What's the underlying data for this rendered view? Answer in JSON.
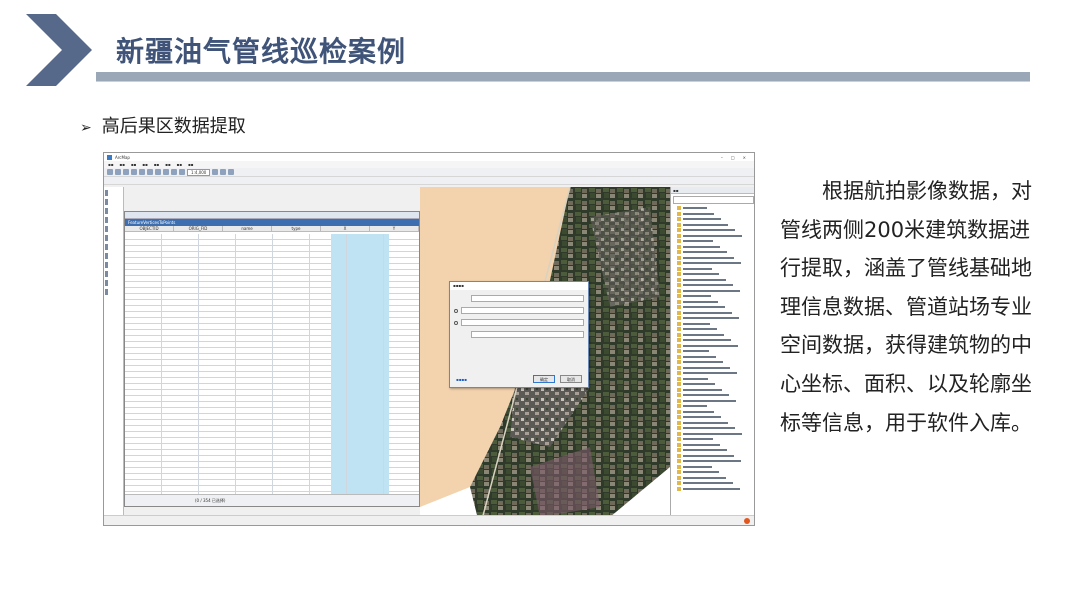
{
  "slide": {
    "title": "新疆油气管线巡检案例",
    "bullet": "高后果区数据提取",
    "description": "根据航拍影像数据，对管线两侧200米建筑数据进行提取，涵盖了管线基础地理信息数据、管道站场专业空间数据，获得建筑物的中心坐标、面积、以及轮廓坐标等信息，用于软件入库。",
    "colors": {
      "title": "#3f5478",
      "chevron": "#56698a",
      "accent_bar": "#9aa7b6"
    }
  },
  "screenshot": {
    "app_title": "ArcMap",
    "scale": "1:4,000",
    "table_title": "FeatureVerticesToPoints",
    "table_columns": [
      "OBJECTID",
      "ORIG_FID",
      "name",
      "type",
      "X",
      "Y"
    ],
    "table_status": "(0 / 354 已选择)",
    "dialog_ok": "确定",
    "dialog_cancel": "取消"
  }
}
